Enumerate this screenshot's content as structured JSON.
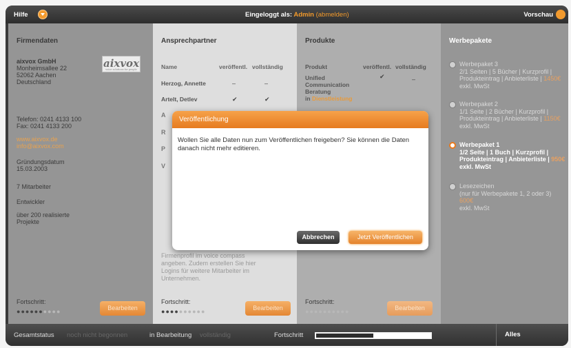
{
  "topbar": {
    "help": "Hilfe",
    "logged_in_prefix": "Eingeloggt als:",
    "user": "Admin",
    "logout": "(abmelden)",
    "preview": "Vorschau"
  },
  "company": {
    "heading": "Firmendaten",
    "name": "aixvox GmbH",
    "street": "Monheimsallee 22",
    "city": "52062 Aachen",
    "country": "Deutschland",
    "logo_text": "aixvox",
    "logo_tagline": "voice solutions for people",
    "phone": "Telefon: 0241 4133 100",
    "fax": "Fax: 0241 4133 200",
    "website": "www.aixvox.de",
    "email": "info@aixvox.com",
    "founded_label": "Gründungsdatum",
    "founded_date": "15.03.2003",
    "employees": "7 Mitarbeiter",
    "category": "Entwickler",
    "projects_line1": "über 200 realisierte",
    "projects_line2": "Projekte",
    "progress_label": "Fortschritt:",
    "progress": 0.6,
    "edit_label": "Bearbeiten"
  },
  "contacts": {
    "heading": "Ansprechpartner",
    "col_name": "Name",
    "col_published": "veröffentl.",
    "col_complete": "vollständig",
    "rows": [
      {
        "name": "Herzog, Annette",
        "published": "–",
        "complete": "–"
      },
      {
        "name": "Artelt, Detlev",
        "published": "✔",
        "complete": "✔"
      }
    ],
    "partial_1": "A",
    "partial_2": "R",
    "partial_3": "P",
    "partial_4": "V",
    "hint_line1": "Firmenprofil im voice compass",
    "hint_line2": "angeben. Zudem erstellen Sie hier",
    "hint_line3": "Logins für weitere Mitarbeiter im",
    "hint_line4": "Unternehmen.",
    "progress_label": "Fortschritt:",
    "progress": 0.4,
    "edit_label": "Bearbeiten"
  },
  "products": {
    "heading": "Produkte",
    "col_product": "Produkt",
    "col_published": "veröffentl.",
    "col_complete": "vollständig",
    "product_line1": "Unified",
    "product_line2": "Communication",
    "product_line3": "Beratung",
    "product_in": "in",
    "product_category": "Dienstleistung",
    "published": "✔",
    "complete": "–",
    "progress_label": "Fortschritt:",
    "progress": 0.0,
    "edit_label": "Bearbeiten"
  },
  "packages": {
    "heading": "Werbepakete",
    "items": [
      {
        "title": "Werbepaket 3",
        "line2": "2/1 Seiten | 5 Bücher | Kurzprofil |",
        "line3": "Produkteintrag | Anbieterliste |",
        "price": "1450€",
        "line4": "exkl. MwSt",
        "selected": false
      },
      {
        "title": "Werbepaket 2",
        "line2": "1/1 Seite | 2 Bücher | Kurzprofil |",
        "line3": "Produkteintrag | Anbieterliste |",
        "price": "1150€",
        "line4": "exkl. MwSt",
        "selected": false
      },
      {
        "title": "Werbepaket 1",
        "line2": "1/2 Seite | 1 Buch | Kurzprofil |",
        "line3": "Produkteintrag | Anbieterliste |",
        "price": "950€",
        "line4": "exkl. MwSt",
        "selected": true
      },
      {
        "title": "Lesezeichen",
        "line2": "(nur für Werbepakete 1, 2 oder 3)",
        "line3": "",
        "price": "600€",
        "line4": "exkl. MwSt",
        "selected": false
      }
    ]
  },
  "statusbar": {
    "overall": "Gesamtstatus",
    "not_started": "noch nicht begonnen",
    "in_progress": "in Bearbeitung",
    "complete": "vollständig",
    "progress_label": "Fortschritt",
    "progress": 0.5,
    "publish_all": "Alles Veröffentlichen"
  },
  "dialog": {
    "title": "Veröffentlichung",
    "message": "Wollen Sie alle Daten nun zum Veröffentlichen freigeben? Sie können die Daten danach nicht mehr editieren.",
    "cancel": "Abbrechen",
    "confirm": "Jetzt Veröffentlichen"
  },
  "colors": {
    "accent": "#e87a1e",
    "dark": "#3a3a3a"
  }
}
